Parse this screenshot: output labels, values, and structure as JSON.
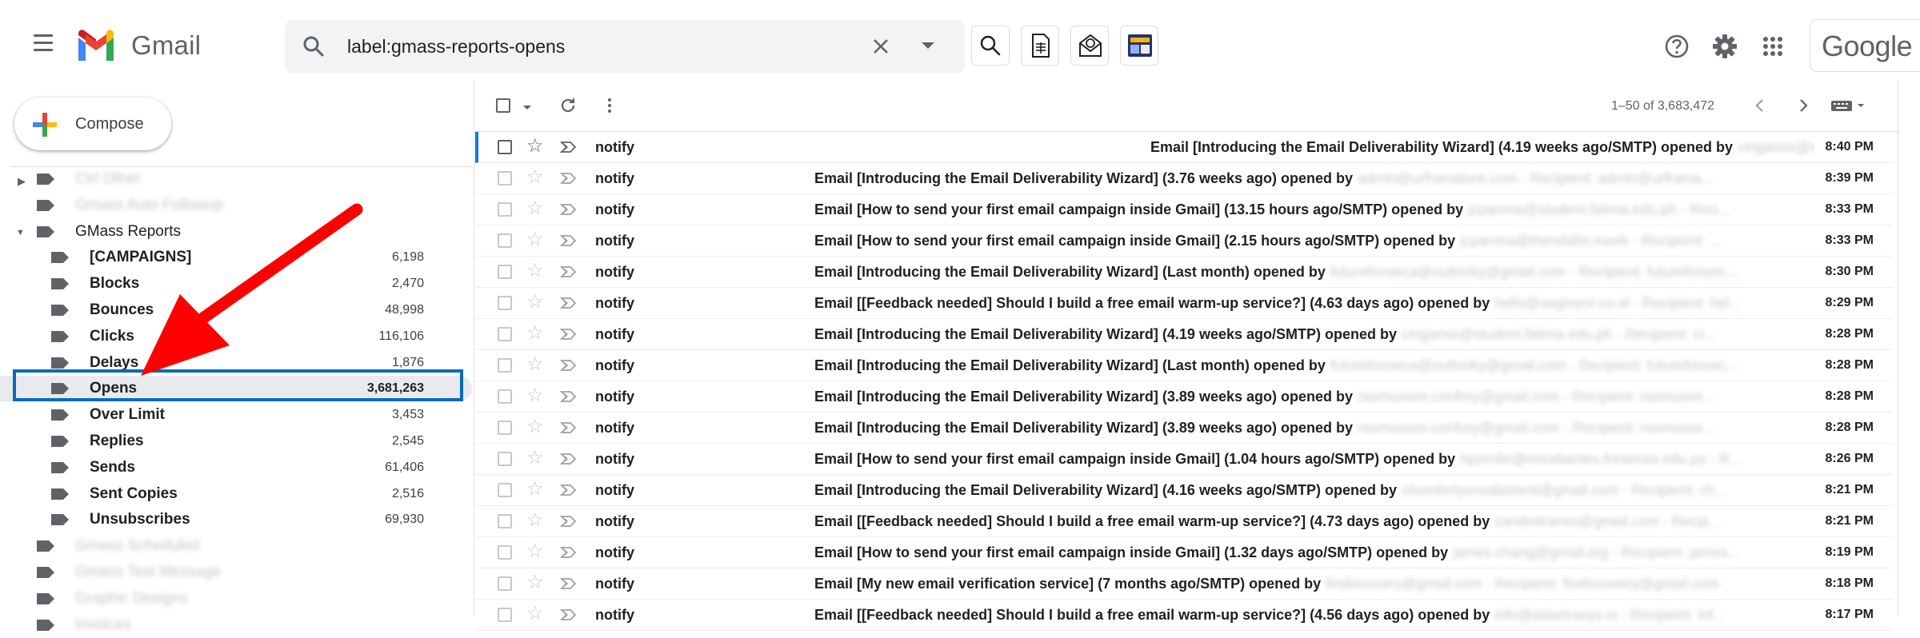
{
  "header": {
    "logo_text": "Gmail",
    "search_query": "label:gmass-reports-opens",
    "brand_badge": "Google"
  },
  "compose": {
    "label": "Compose"
  },
  "sidebar": {
    "labels": [
      {
        "name": "Ctrl Other",
        "count": "",
        "blurred": true,
        "caret": true
      },
      {
        "name": "Gmass Auto Followup",
        "count": "",
        "blurred": true
      },
      {
        "name": "GMass Reports",
        "count": "",
        "caret": "open"
      },
      {
        "name": "[CAMPAIGNS]",
        "count": "6,198",
        "sub": true
      },
      {
        "name": "Blocks",
        "count": "2,470",
        "sub": true
      },
      {
        "name": "Bounces",
        "count": "48,998",
        "sub": true
      },
      {
        "name": "Clicks",
        "count": "116,106",
        "sub": true
      },
      {
        "name": "Delays",
        "count": "1,876",
        "sub": true
      },
      {
        "name": "Opens",
        "count": "3,681,263",
        "sub": true,
        "active": true
      },
      {
        "name": "Over Limit",
        "count": "3,453",
        "sub": true
      },
      {
        "name": "Replies",
        "count": "2,545",
        "sub": true
      },
      {
        "name": "Sends",
        "count": "61,406",
        "sub": true
      },
      {
        "name": "Sent Copies",
        "count": "2,516",
        "sub": true
      },
      {
        "name": "Unsubscribes",
        "count": "69,930",
        "sub": true
      },
      {
        "name": "Gmass Scheduled",
        "count": "",
        "blurred": true
      },
      {
        "name": "Gmass Test Message",
        "count": "",
        "blurred": true
      },
      {
        "name": "Graphic Designs",
        "count": "",
        "blurred": true
      },
      {
        "name": "Invoices",
        "count": "",
        "blurred": true
      }
    ]
  },
  "toolbar": {
    "pagination": "1–50 of 3,683,472"
  },
  "messages": [
    {
      "sender": "notify",
      "subject": "Email [Introducing the Email Deliverability Wizard] (4.19 weeks ago/SMTP) opened by",
      "snippet": "cingaroix@student.fatima.edu.ph - Recipient: ci...",
      "time": "8:40 PM"
    },
    {
      "sender": "notify",
      "subject": "Email [Introducing the Email Deliverability Wizard] (3.76 weeks ago) opened by",
      "snippet": "admin@urframature.com - Recipient: admin@urframa...",
      "time": "8:39 PM"
    },
    {
      "sender": "notify",
      "subject": "Email [How to send your first email campaign inside Gmail] (13.15 hours ago/SMTP) opened by",
      "snippet": "jcparona@student.fatima.edu.ph - Reci...",
      "time": "8:33 PM"
    },
    {
      "sender": "notify",
      "subject": "Email [How to send your first email campaign inside Gmail] (2.15 hours ago/SMTP) opened by",
      "snippet": "jcparona@thendafin.meek - Recipient: ...",
      "time": "8:33 PM"
    },
    {
      "sender": "notify",
      "subject": "Email [Introducing the Email Deliverability Wizard] (Last month) opened by",
      "snippet": "futurefonseca@outlooky@gmail.com - Recipient: futurefonsec...",
      "time": "8:30 PM"
    },
    {
      "sender": "notify",
      "subject": "Email [[Feedback needed] Should I build a free email warm-up service?] (4.63 days ago) opened by",
      "snippet": "hello@segment.co.id - Recipient: hel...",
      "time": "8:29 PM"
    },
    {
      "sender": "notify",
      "subject": "Email [Introducing the Email Deliverability Wizard] (4.19 weeks ago/SMTP) opened by",
      "snippet": "cingaroix@student.fatima.edu.ph - Recipient: ci...",
      "time": "8:28 PM"
    },
    {
      "sender": "notify",
      "subject": "Email [Introducing the Email Deliverability Wizard] (Last month) opened by",
      "snippet": "futurefonseca@outlooky@gmail.com - Recipient: futurefonsec...",
      "time": "8:28 PM"
    },
    {
      "sender": "notify",
      "subject": "Email [Introducing the Email Deliverability Wizard] (3.89 weeks ago) opened by",
      "snippet": "rasmussen.confory@gmail.com - Recipient: rasmusse...",
      "time": "8:28 PM"
    },
    {
      "sender": "notify",
      "subject": "Email [Introducing the Email Deliverability Wizard] (3.89 weeks ago) opened by",
      "snippet": "rasmussen.confory@gmail.com - Recipient: rasmusse...",
      "time": "8:28 PM"
    },
    {
      "sender": "notify",
      "subject": "Email [How to send your first email campaign inside Gmail] (1.04 hours ago/SMTP) opened by",
      "snippet": "hporrille@estudiantes.fresenas.edu.py - R...",
      "time": "8:26 PM"
    },
    {
      "sender": "notify",
      "subject": "Email [Introducing the Email Deliverability Wizard] (4.16 weeks ago/SMTP) opened by",
      "snippet": "chomfertyonsabistent@gmail.com - Recipient: ch...",
      "time": "8:21 PM"
    },
    {
      "sender": "notify",
      "subject": "Email [[Feedback needed] Should I build a free email warm-up service?] (4.73 days ago) opened by",
      "snippet": "carabotranso@gmail.com - Recip...",
      "time": "8:21 PM"
    },
    {
      "sender": "notify",
      "subject": "Email [How to send your first email campaign inside Gmail] (1.32 days ago/SMTP) opened by",
      "snippet": "james.chang@gmail.org - Recipient: james...",
      "time": "8:19 PM"
    },
    {
      "sender": "notify",
      "subject": "Email [My new email verification service] (7 months ago/SMTP) opened by",
      "snippet": "findiscovery@gmail.com - Recipient: findiscovery@gmail.com",
      "time": "8:18 PM"
    },
    {
      "sender": "notify",
      "subject": "Email [[Feedback needed] Should I build a free email warm-up service?] (4.56 days ago) opened by",
      "snippet": "info@adastrasys.io - Recipient: inf...",
      "time": "8:17 PM"
    }
  ],
  "colors": {
    "highlight_box": "#0b6bb5",
    "annotation_arrow": "#ff0000",
    "active_row_bg": "#e8eaed",
    "selected_row_marker": "#1a73e8"
  },
  "icons": {
    "header": [
      "menu-icon",
      "gmail-logo",
      "search-icon",
      "close-icon",
      "search-options-icon",
      "search-tool-icon",
      "document-icon",
      "mail-tracking-icon",
      "campaign-icon",
      "help-icon",
      "settings-icon",
      "apps-icon"
    ],
    "toolbar": [
      "select-checkbox",
      "refresh-icon",
      "more-icon",
      "prev-page-icon",
      "next-page-icon",
      "keyboard-icon"
    ],
    "row": [
      "checkbox",
      "star-icon",
      "important-icon"
    ]
  }
}
